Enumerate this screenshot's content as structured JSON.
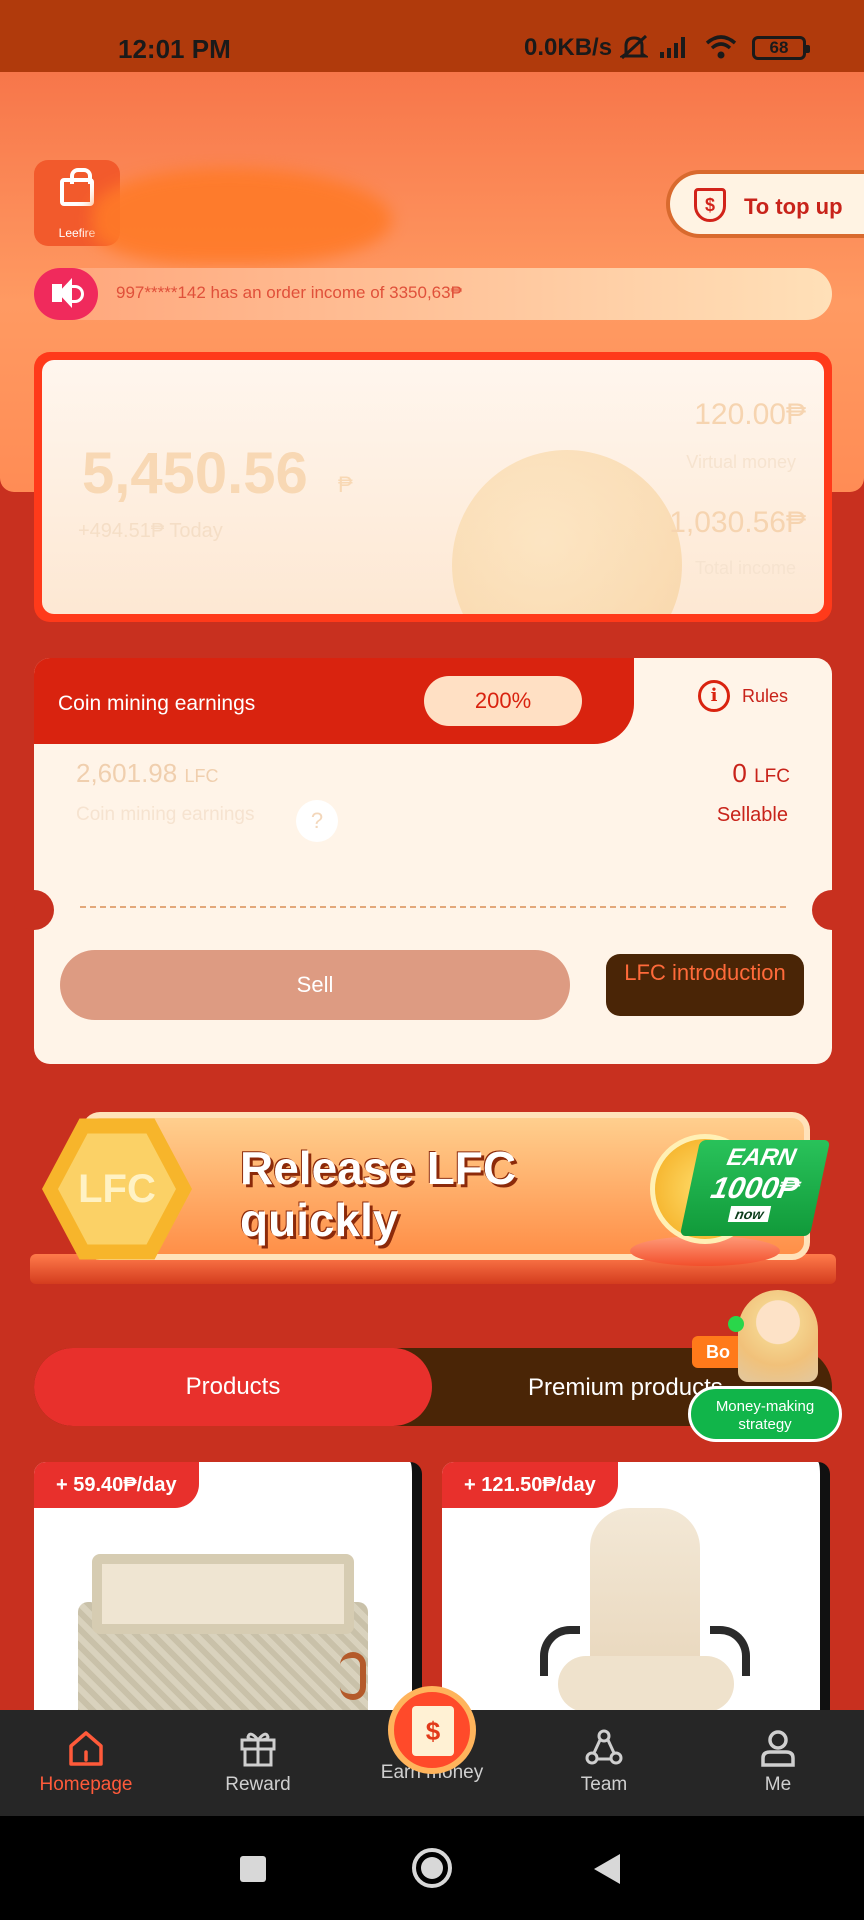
{
  "status_bar": {
    "time": "12:01 PM",
    "network": "0.0KB/s",
    "battery": "68"
  },
  "header": {
    "logo_text": "Leefire",
    "top_up_label": "To top up",
    "ticker_text": "997*****142 has an order income of 3350,63₱"
  },
  "balance": {
    "main": "5,450.56",
    "currency": "₱",
    "today": "+494.51₱ Today",
    "virtual_value": "120.00₱",
    "virtual_label": "Virtual money",
    "total_value": "1,030.56₱",
    "total_label": "Total income"
  },
  "mining": {
    "title": "Coin mining earnings",
    "percent": "200%",
    "rules_label": "Rules",
    "earned_value": "2,601.98",
    "earned_unit": "LFC",
    "earned_label": "Coin mining earnings",
    "sellable_value": "0",
    "sellable_unit": "LFC",
    "sellable_label": "Sellable",
    "sell_label": "Sell",
    "intro_label": "LFC introduction"
  },
  "banner": {
    "hex_text": "LFC",
    "line1": "Release LFC",
    "line2": "quickly",
    "earn": "EARN",
    "amount": "1000₱",
    "now": "now"
  },
  "tabs": {
    "products": "Products",
    "premium": "Premium products"
  },
  "float": {
    "bonus": "Bo",
    "strategy": "Money-making strategy"
  },
  "products": [
    {
      "rate": "+ 59.40₱/day",
      "image": "basket"
    },
    {
      "rate": "+ 121.50₱/day",
      "image": "chair"
    }
  ],
  "nav": {
    "home": "Homepage",
    "reward": "Reward",
    "earn": "Earn money",
    "team": "Team",
    "me": "Me",
    "active": "home"
  },
  "colors": {
    "accent": "#e8302c",
    "active_nav": "#ff5a3a",
    "dark_brown": "#4a2506"
  }
}
